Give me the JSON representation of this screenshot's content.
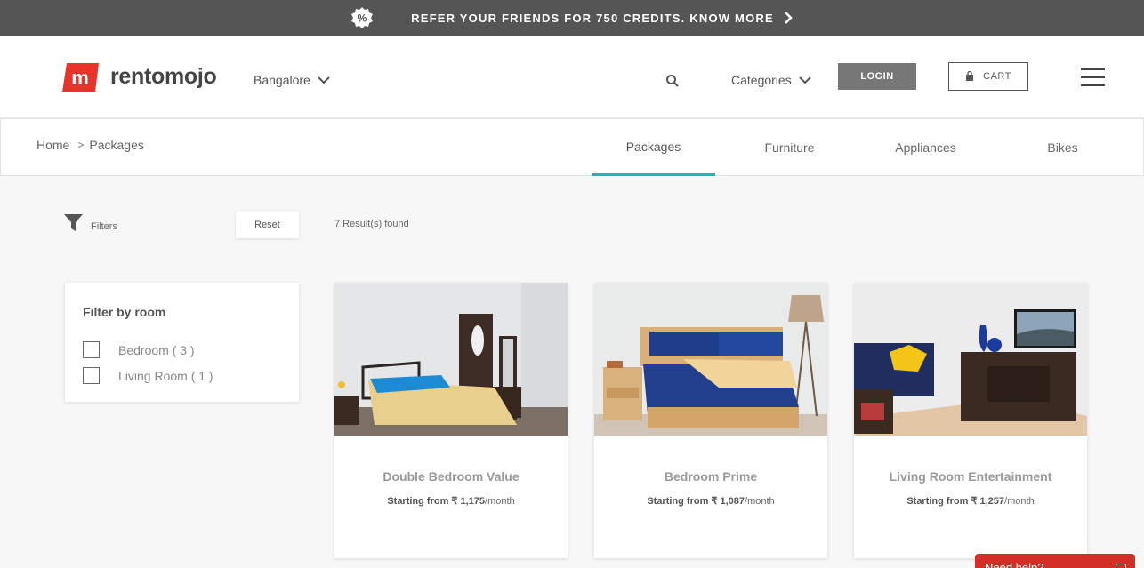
{
  "promo": {
    "badge_symbol": "%",
    "text": "REFER YOUR FRIENDS FOR 750 CREDITS. KNOW MORE"
  },
  "header": {
    "logo_letter": "m",
    "logo_text": "rentomojo",
    "city": "Bangalore",
    "categories": "Categories",
    "login": "LOGIN",
    "cart": "CART",
    "brand_color": "#e8332b"
  },
  "breadcrumb": {
    "home": "Home",
    "separator": ">",
    "current": "Packages"
  },
  "tabs": [
    {
      "label": "Packages",
      "active": true
    },
    {
      "label": "Furniture",
      "active": false
    },
    {
      "label": "Appliances",
      "active": false
    },
    {
      "label": "Bikes",
      "active": false
    }
  ],
  "accent_color": "#1fb5b5",
  "filters": {
    "label": "Filters",
    "reset": "Reset",
    "results": "7 Result(s) found",
    "panel_title": "Filter by room",
    "options": [
      {
        "label": "Bedroom ( 3 )",
        "checked": false
      },
      {
        "label": "Living Room ( 1 )",
        "checked": false
      }
    ]
  },
  "products": [
    {
      "name": "Double Bedroom Value",
      "price_prefix": "Starting from",
      "price": "₹ 1,175",
      "price_suffix": "/month",
      "image": "bedroom-scene-with-wardrobe"
    },
    {
      "name": "Bedroom Prime",
      "price_prefix": "Starting from",
      "price": "₹ 1,087",
      "price_suffix": "/month",
      "image": "bedroom-scene-with-lamp"
    },
    {
      "name": "Living Room Entertainment",
      "price_prefix": "Starting from",
      "price": "₹ 1,257",
      "price_suffix": "/month",
      "image": "living-room-scene-with-tv"
    }
  ],
  "help": {
    "label": "Need help?"
  }
}
